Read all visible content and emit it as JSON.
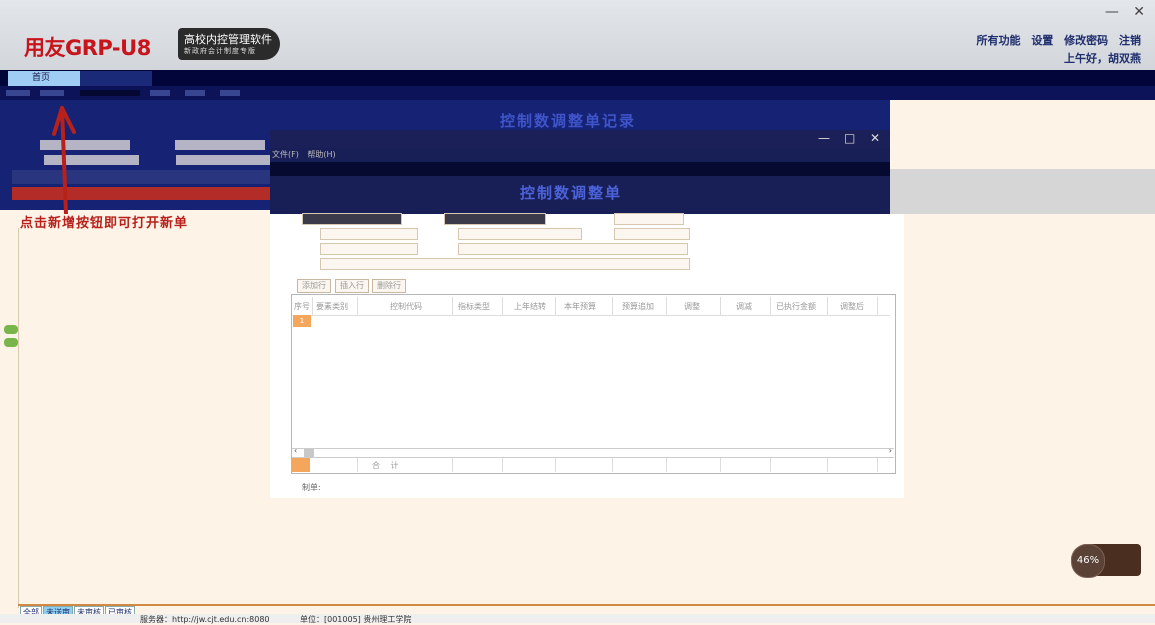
{
  "header": {
    "logo_text": "用友GRP-U8",
    "logo_badge_line1": "高校内控管理软件",
    "logo_badge_line2": "新政府会计制度专版",
    "top_menu": [
      "所有功能",
      "设置",
      "修改密码",
      "注销"
    ],
    "greeting": "上午好，胡双燕",
    "window_minimize": "—",
    "window_close": "✕"
  },
  "nav": {
    "home_tab": "首页"
  },
  "background_panel": {
    "title": "控制数调整单记录"
  },
  "red_banner": "点击新增按钮即可打开新单",
  "dialog": {
    "menu": [
      "文件(F)",
      "帮助(H)"
    ],
    "title": "控制数调整单",
    "buttons": [
      "添加行",
      "插入行",
      "删除行"
    ],
    "grid_columns": [
      "序号",
      "要素类别",
      "控制代码",
      "指标类型",
      "上年结转",
      "本年预算",
      "预算追加",
      "调整",
      "调减",
      "已执行金额",
      "调整后"
    ],
    "row_number": "1",
    "sum_label": "合 计",
    "maker_label": "制单:"
  },
  "bottom_tabs": [
    "全部",
    "未送审",
    "未审核",
    "已审核"
  ],
  "status": {
    "server": "服务器：http://jw.cjt.edu.cn:8080",
    "unit": "单位：[001005] 贵州理工学院"
  },
  "cpu": {
    "percent": "46%"
  }
}
